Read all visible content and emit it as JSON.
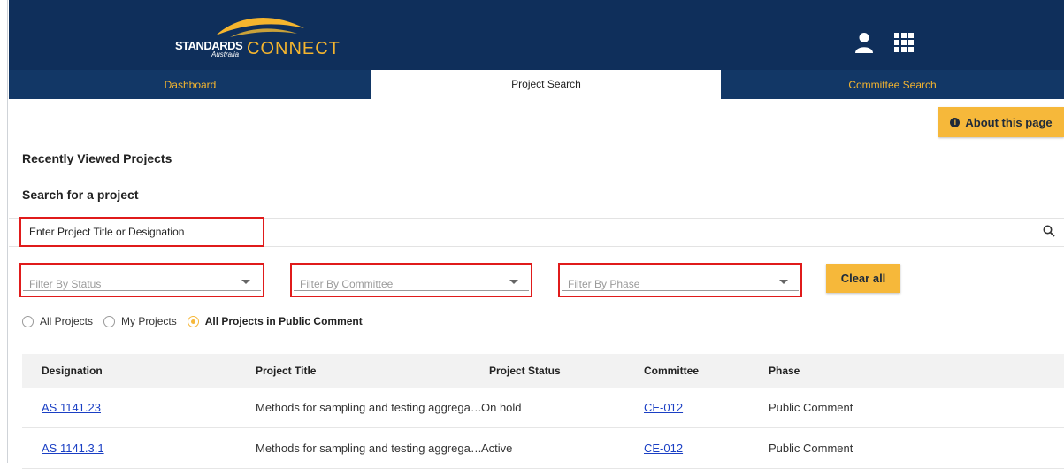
{
  "header": {
    "logo": {
      "standards": "STANDARDS",
      "australia": "Australia",
      "connect": "CONNECT"
    },
    "icons": {
      "user": "user-icon",
      "apps": "apps-grid-icon"
    }
  },
  "tabs": [
    {
      "label": "Dashboard",
      "active": false
    },
    {
      "label": "Project Search",
      "active": true
    },
    {
      "label": "Committee Search",
      "active": false
    }
  ],
  "about_button": {
    "label": "About this page",
    "icon": "info-icon"
  },
  "recently_viewed_title": "Recently Viewed Projects",
  "search_title": "Search for a project",
  "search": {
    "placeholder": "Enter Project Title or Designation",
    "icon": "search-icon"
  },
  "filters": {
    "status": "Filter By Status",
    "committee": "Filter By Committee",
    "phase": "Filter By Phase",
    "clear_label": "Clear all"
  },
  "radios": [
    {
      "label": "All Projects",
      "selected": false
    },
    {
      "label": "My Projects",
      "selected": false
    },
    {
      "label": "All Projects in Public Comment",
      "selected": true
    }
  ],
  "table": {
    "columns": [
      "Designation",
      "Project Title",
      "Project Status",
      "Committee",
      "Phase"
    ],
    "rows": [
      {
        "designation": "AS 1141.23",
        "title": "Methods for sampling and testing aggrega…",
        "status": "On hold",
        "committee": "CE-012",
        "phase": "Public Comment"
      },
      {
        "designation": "AS 1141.3.1",
        "title": "Methods for sampling and testing aggrega…",
        "status": "Active",
        "committee": "CE-012",
        "phase": "Public Comment"
      }
    ]
  },
  "colors": {
    "header_bg": "#0f2f5b",
    "tab_bg": "#123766",
    "accent": "#f6b83a",
    "highlight_box": "#e01b1b",
    "link": "#1a3fc4"
  }
}
